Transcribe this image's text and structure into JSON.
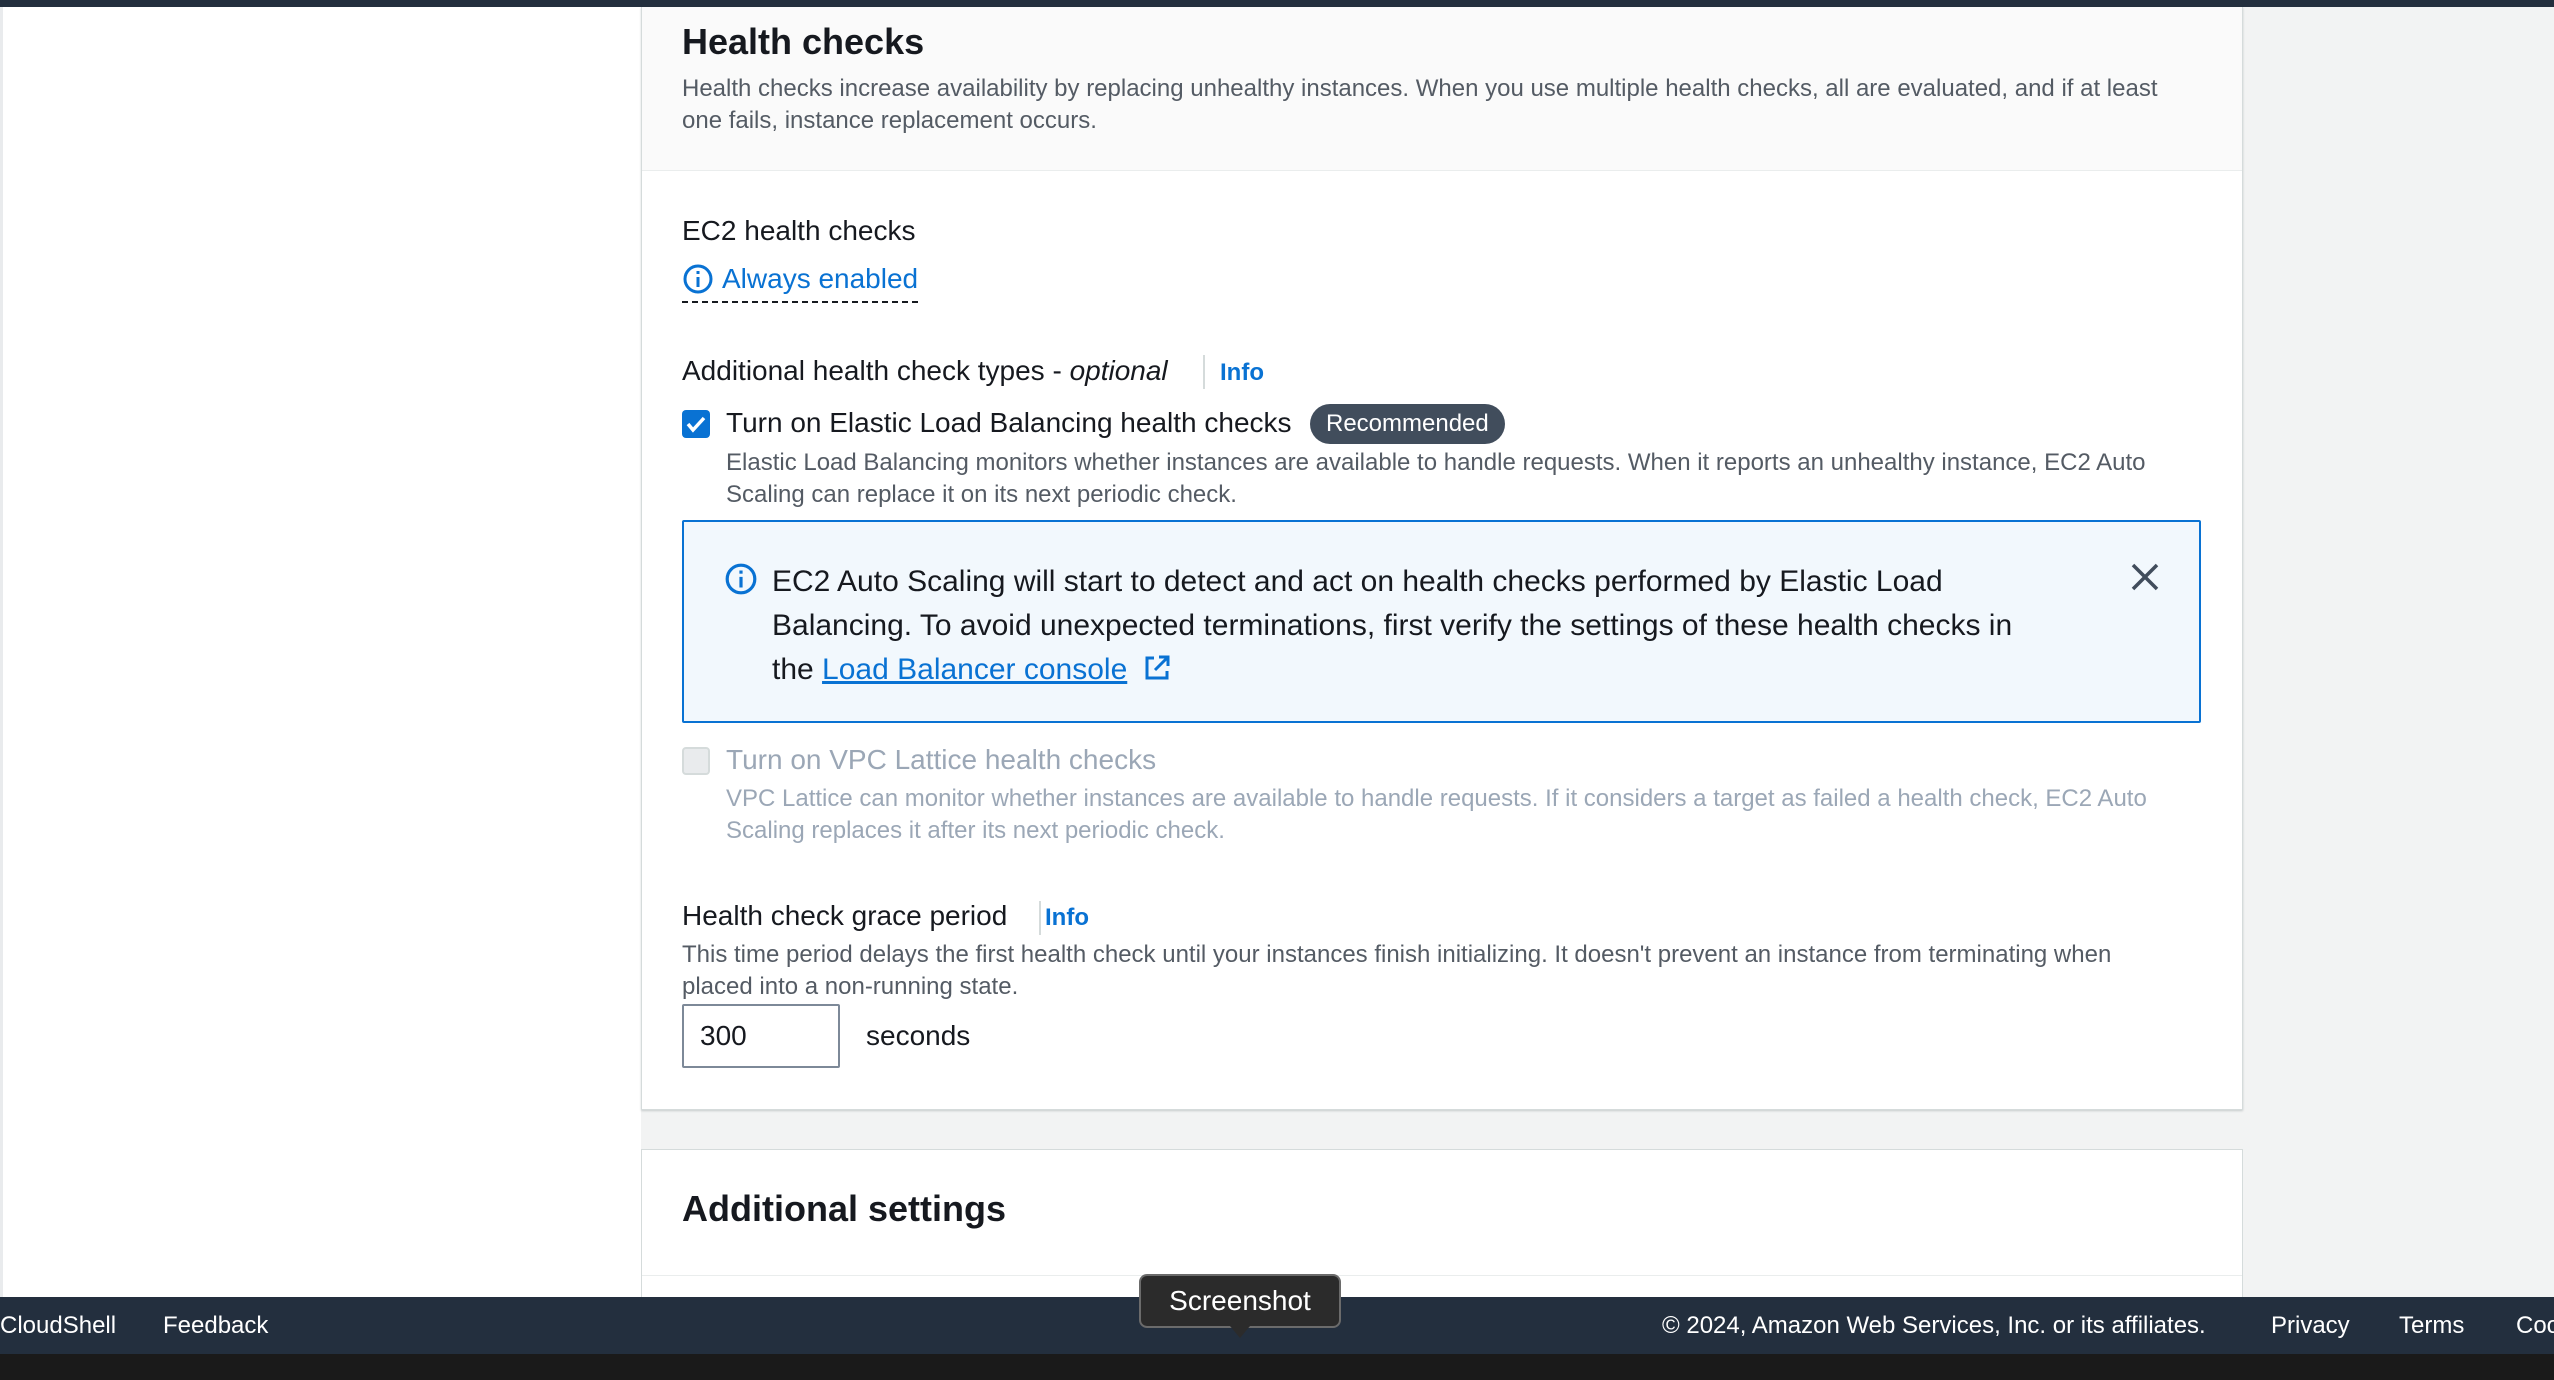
{
  "health_checks": {
    "title": "Health checks",
    "description_line1": "Health checks increase availability by replacing unhealthy instances. When you use multiple health checks, all are evaluated, and if at least",
    "description_line2": "one fails, instance replacement occurs.",
    "ec2_label": "EC2 health checks",
    "always_enabled": "Always enabled",
    "additional_label": "Additional health check types - ",
    "additional_optional": "optional",
    "info": "Info",
    "elb": {
      "checked": true,
      "label": "Turn on Elastic Load Balancing health checks",
      "badge": "Recommended",
      "desc_line1": "Elastic Load Balancing monitors whether instances are available to handle requests. When it reports an unhealthy instance, EC2 Auto",
      "desc_line2": "Scaling can replace it on its next periodic check."
    },
    "alert": {
      "text_before": "EC2 Auto Scaling will start to detect and act on health checks performed by Elastic Load Balancing. To avoid unexpected terminations, first verify the settings of these health checks in the ",
      "link": "Load Balancer console"
    },
    "vpc_lattice": {
      "checked": false,
      "disabled": true,
      "label": "Turn on VPC Lattice health checks",
      "desc_line1": "VPC Lattice can monitor whether instances are available to handle requests. If it considers a target as failed a health check, EC2 Auto",
      "desc_line2": "Scaling replaces it after its next periodic check."
    },
    "grace": {
      "label": "Health check grace period",
      "info": "Info",
      "desc_line1": "This time period delays the first health check until your instances finish initializing. It doesn't prevent an instance from terminating when",
      "desc_line2": "placed into a non-running state.",
      "value": "300",
      "unit": "seconds"
    }
  },
  "additional_settings": {
    "title": "Additional settings"
  },
  "footer": {
    "cloudshell": "CloudShell",
    "feedback": "Feedback",
    "copyright": "© 2024, Amazon Web Services, Inc. or its affiliates.",
    "privacy": "Privacy",
    "terms": "Terms",
    "cookie": "Coo"
  },
  "tooltip": "Screenshot",
  "colors": {
    "accent": "#0972d3",
    "nav_dark": "#232f3e",
    "badge": "#414d5c"
  }
}
